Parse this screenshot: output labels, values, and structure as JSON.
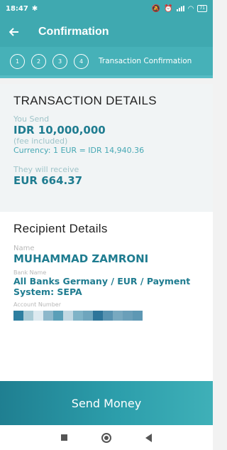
{
  "status_bar": {
    "time": "18:47",
    "battery": "71"
  },
  "header": {
    "title": "Confirmation"
  },
  "stepper": {
    "steps": [
      "1",
      "2",
      "3",
      "4"
    ],
    "label": "Transaction Confirmation"
  },
  "transaction": {
    "heading": "TRANSACTION DETAILS",
    "send_label": "You Send",
    "send_amount": "IDR 10,000,000",
    "fee_note": "(fee included)",
    "currency_rate": "Currency: 1 EUR = IDR 14,940.36",
    "receive_label": "They will receive",
    "receive_amount": "EUR 664.37"
  },
  "recipient": {
    "heading": "Recipient Details",
    "name_label": "Name",
    "name_value": "MUHAMMAD ZAMRONI",
    "bank_label": "Bank Name",
    "bank_value": "All Banks Germany / EUR / Payment System: SEPA",
    "account_label": "Account Number"
  },
  "actions": {
    "send_button": "Send Money"
  },
  "colors": {
    "primary": "#3fa9b0",
    "accent_text": "#1f7c90",
    "button_dark": "#1f7f91"
  }
}
